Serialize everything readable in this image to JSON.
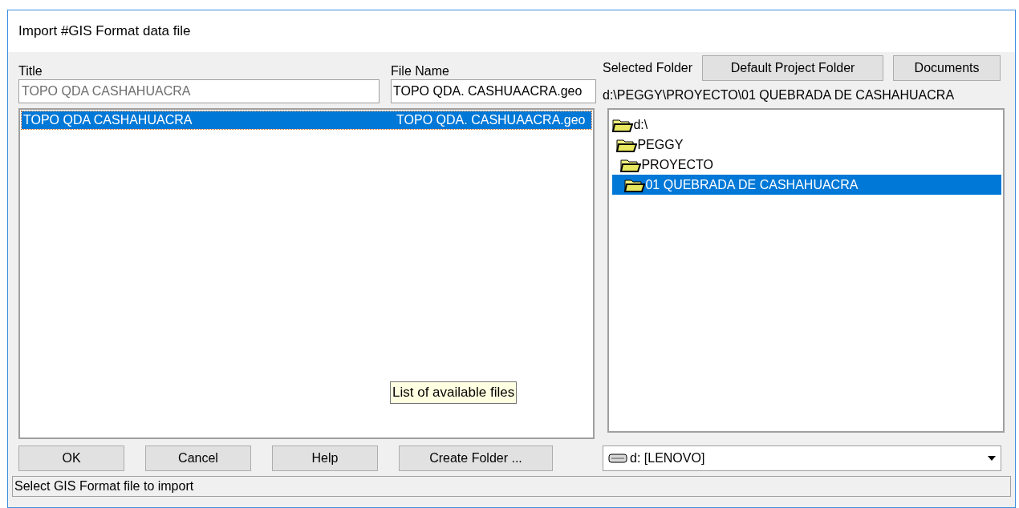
{
  "window": {
    "title": "Import #GIS Format data file"
  },
  "title_field": {
    "label": "Title",
    "value": "TOPO QDA CASHAHUACRA",
    "disabled": true
  },
  "file_name_field": {
    "label": "File Name",
    "value": "TOPO QDA. CASHUAACRA.geo"
  },
  "selected_folder": {
    "label": "Selected Folder",
    "path": "d:\\PEGGY\\PROYECTO\\01 QUEBRADA DE CASHAHUACRA"
  },
  "folder_buttons": [
    "Default Project Folder",
    "Documents"
  ],
  "file_list": [
    {
      "title": "TOPO QDA CASHAHUACRA",
      "file_name": "TOPO QDA. CASHUAACRA.geo",
      "selected": true
    }
  ],
  "tooltip": "List of available files",
  "folder_tree": [
    {
      "label": "d:\\",
      "selected": false,
      "children": [
        {
          "label": "PEGGY",
          "selected": false,
          "children": [
            {
              "label": "PROYECTO",
              "selected": false,
              "children": [
                {
                  "label": "01 QUEBRADA DE CASHAHUACRA",
                  "selected": true
                }
              ]
            }
          ]
        }
      ]
    }
  ],
  "buttons": [
    "OK",
    "Cancel",
    "Help",
    "Create Folder ..."
  ],
  "drive_select": {
    "value": "d: [LENOVO]"
  },
  "status_bar": "Select GIS Format file to import"
}
